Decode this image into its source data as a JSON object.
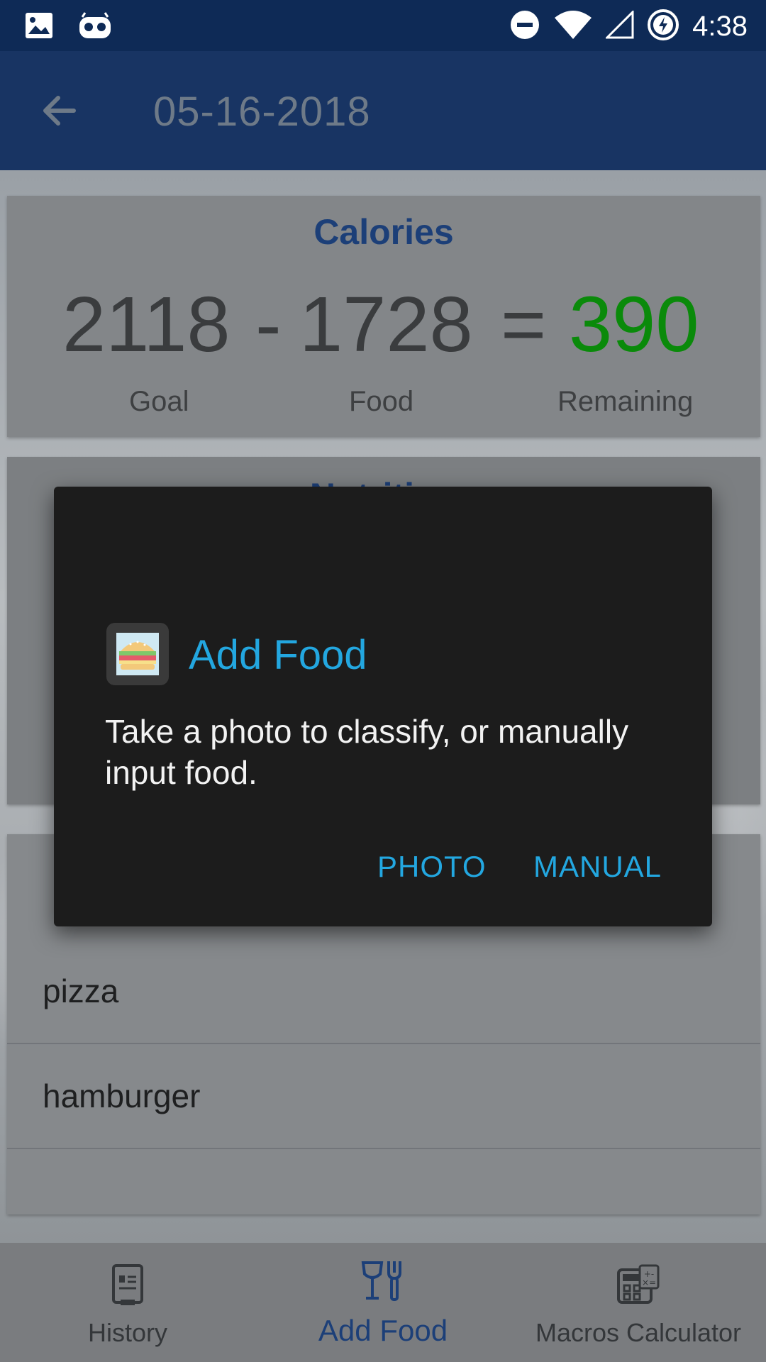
{
  "status_bar": {
    "time": "4:38",
    "left_icons": [
      "image-icon",
      "android-debug-icon"
    ],
    "right_icons": [
      "do-not-disturb-icon",
      "wifi-icon",
      "cell-signal-icon",
      "battery-charging-icon"
    ]
  },
  "app_bar": {
    "back_icon": "arrow-back-icon",
    "title": "05-16-2018"
  },
  "calories": {
    "title": "Calories",
    "goal_value": "2118",
    "minus": "-",
    "food_value": "1728",
    "equals": "=",
    "remaining_value": "390",
    "goal_label": "Goal",
    "food_label": "Food",
    "remaining_label": "Remaining",
    "remaining_color": "#0a8a0a"
  },
  "nutrition": {
    "title": "Nutrition"
  },
  "food_list": {
    "items": [
      "pizza",
      "hamburger"
    ]
  },
  "dialog": {
    "icon": "hamburger-icon",
    "title": "Add Food",
    "message": "Take a photo to classify, or manually input food.",
    "buttons": {
      "photo": "PHOTO",
      "manual": "MANUAL"
    },
    "accent_color": "#23a7e0"
  },
  "bottom_nav": {
    "items": [
      {
        "label": "History",
        "icon": "journal-icon",
        "active": false
      },
      {
        "label": "Add Food",
        "icon": "wine-fork-icon",
        "active": true
      },
      {
        "label": "Macros Calculator",
        "icon": "calculator-icon",
        "active": false
      }
    ]
  }
}
